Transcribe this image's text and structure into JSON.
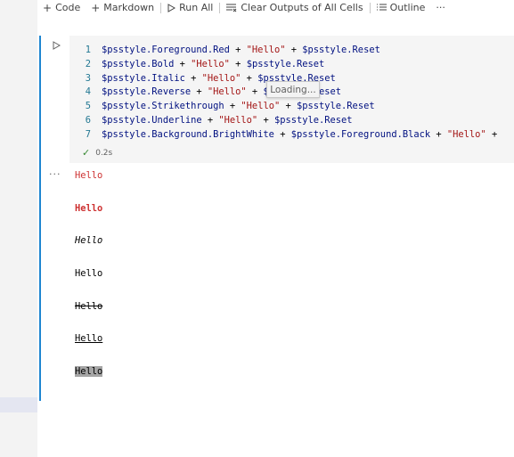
{
  "toolbar": {
    "code_label": "Code",
    "markdown_label": "Markdown",
    "run_all_label": "Run All",
    "clear_outputs_label": "Clear Outputs of All Cells",
    "outline_label": "Outline",
    "more_label": "···"
  },
  "cell": {
    "lines": [
      {
        "n": "1",
        "parts": [
          [
            "var",
            "$psstyle.Foreground.Red"
          ],
          [
            "op",
            " + "
          ],
          [
            "str",
            "\"Hello\""
          ],
          [
            "op",
            " + "
          ],
          [
            "var",
            "$psstyle.Reset"
          ]
        ]
      },
      {
        "n": "2",
        "parts": [
          [
            "var",
            "$psstyle.Bold"
          ],
          [
            "op",
            " + "
          ],
          [
            "str",
            "\"Hello\""
          ],
          [
            "op",
            " + "
          ],
          [
            "var",
            "$psstyle.Reset"
          ]
        ]
      },
      {
        "n": "3",
        "parts": [
          [
            "var",
            "$psstyle.Italic"
          ],
          [
            "op",
            " + "
          ],
          [
            "str",
            "\"Hello\""
          ],
          [
            "op",
            " + "
          ],
          [
            "var",
            "$psstyle.Reset"
          ]
        ]
      },
      {
        "n": "4",
        "parts": [
          [
            "var",
            "$psstyle.Reverse"
          ],
          [
            "op",
            " + "
          ],
          [
            "str",
            "\"Hello\""
          ],
          [
            "op",
            " + "
          ],
          [
            "var",
            "$psstyle.Reset"
          ]
        ]
      },
      {
        "n": "5",
        "parts": [
          [
            "var",
            "$psstyle.Strikethrough"
          ],
          [
            "op",
            " + "
          ],
          [
            "str",
            "\"Hello\""
          ],
          [
            "op",
            " + "
          ],
          [
            "var",
            "$psstyle.Reset"
          ]
        ]
      },
      {
        "n": "6",
        "parts": [
          [
            "var",
            "$psstyle.Underline"
          ],
          [
            "op",
            " + "
          ],
          [
            "str",
            "\"Hello\""
          ],
          [
            "op",
            " + "
          ],
          [
            "var",
            "$psstyle.Reset"
          ]
        ]
      },
      {
        "n": "7",
        "parts": [
          [
            "var",
            "$psstyle.Background.BrightWhite"
          ],
          [
            "op",
            " + "
          ],
          [
            "var",
            "$psstyle.Foreground.Black"
          ],
          [
            "op",
            " + "
          ],
          [
            "str",
            "\"Hello\""
          ],
          [
            "op",
            " +"
          ]
        ]
      }
    ],
    "tooltip": "Loading...",
    "exec_time": "0.2s"
  },
  "output": {
    "more_label": "···",
    "lines": [
      "Hello",
      "Hello",
      "Hello",
      "Hello",
      "Hello",
      "Hello",
      "Hello"
    ]
  },
  "colors": {
    "accent": "#1f86d1",
    "output_red": "#cd3131",
    "success": "#388a34"
  }
}
